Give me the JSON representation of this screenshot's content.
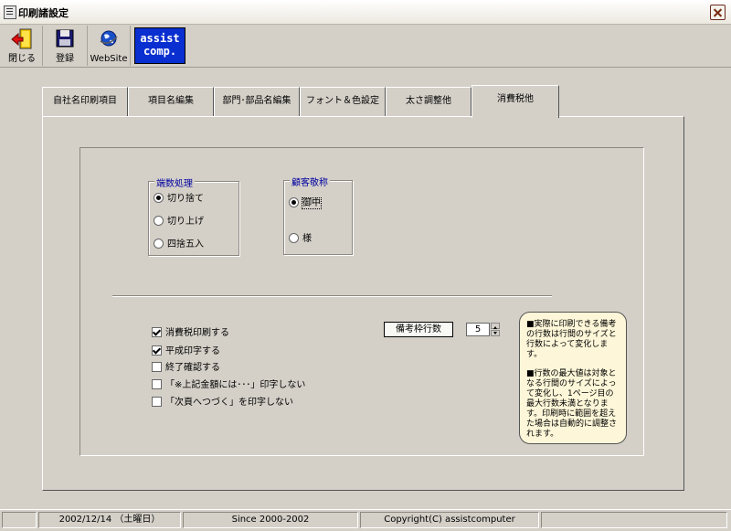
{
  "window": {
    "title": "印刷諸設定"
  },
  "toolbar": {
    "close_label": "閉じる",
    "register_label": "登録",
    "website_label": "WebSite",
    "logo_line1": "assist",
    "logo_line2": "comp."
  },
  "tabs": [
    {
      "label": "自社名印刷項目",
      "active": false
    },
    {
      "label": "項目名編集",
      "active": false
    },
    {
      "label": "部門･部品名編集",
      "active": false
    },
    {
      "label": "フォント＆色設定",
      "active": false
    },
    {
      "label": "太さ調整他",
      "active": false
    },
    {
      "label": "消費税他",
      "active": true
    }
  ],
  "rounding": {
    "title": "端数処理",
    "options": [
      {
        "label": "切り捨て",
        "selected": true
      },
      {
        "label": "切り上げ",
        "selected": false
      },
      {
        "label": "四捨五入",
        "selected": false
      }
    ]
  },
  "honorific": {
    "title": "顧客敬称",
    "options": [
      {
        "label": "御中",
        "selected": true
      },
      {
        "label": "様",
        "selected": false
      }
    ]
  },
  "checks": [
    {
      "label": "消費税印刷する",
      "checked": true
    },
    {
      "label": "平成印字する",
      "checked": true
    },
    {
      "label": "終了確認する",
      "checked": false
    },
    {
      "label": "「※上記金額には･･･」印字しない",
      "checked": false
    },
    {
      "label": "「次頁へつづく」を印字しない",
      "checked": false
    }
  ],
  "remarks_rows": {
    "label": "備考枠行数",
    "value": "5"
  },
  "note": {
    "para1": "■実際に印刷できる備考の行数は行間のサイズと行数によって変化します。",
    "para2": "■行数の最大値は対象となる行間のサイズによって変化し、1ページ目の最大行数未満となります。印刷時に範囲を超えた場合は自動的に調整されます。"
  },
  "status": {
    "date": "2002/12/14 （土曜日）",
    "since": "Since 2000-2002",
    "copyright": "Copyright(C) assistcomputer"
  },
  "colors": {
    "face": "#d4d0c8",
    "logo_bg": "#0a2fd0",
    "group_title": "#0000a0",
    "note_bg": "#fdf6d8"
  }
}
